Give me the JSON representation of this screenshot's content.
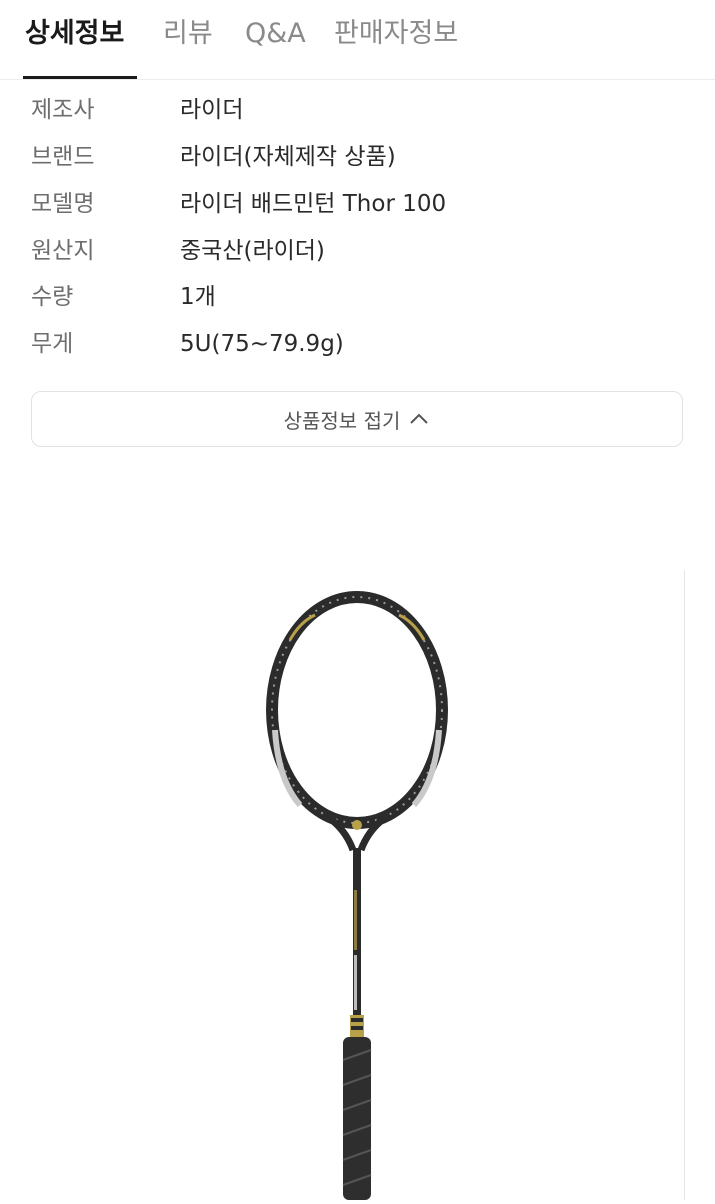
{
  "tabs": [
    {
      "label": "상세정보",
      "active": true
    },
    {
      "label": "리뷰",
      "active": false
    },
    {
      "label": "Q&A",
      "active": false
    },
    {
      "label": "판매자정보",
      "active": false
    }
  ],
  "specs": [
    {
      "key": "제조사",
      "value": "라이더"
    },
    {
      "key": "브랜드",
      "value": "라이더(자체제작 상품)"
    },
    {
      "key": "모델명",
      "value": "라이더 배드민턴 Thor 100"
    },
    {
      "key": "원산지",
      "value": "중국산(라이더)"
    },
    {
      "key": "수량",
      "value": "1개"
    },
    {
      "key": "무게",
      "value": "5U(75~79.9g)"
    }
  ],
  "collapse_button": {
    "label": "상품정보 접기",
    "icon": "chevron-up-icon"
  },
  "product_image": {
    "subject": "badminton-racket"
  },
  "colors": {
    "active_tab": "#1a1a1a",
    "inactive_tab": "#8a8a8a",
    "racket_frame": "#2b2b2b",
    "racket_accent": "#b9a14a"
  }
}
